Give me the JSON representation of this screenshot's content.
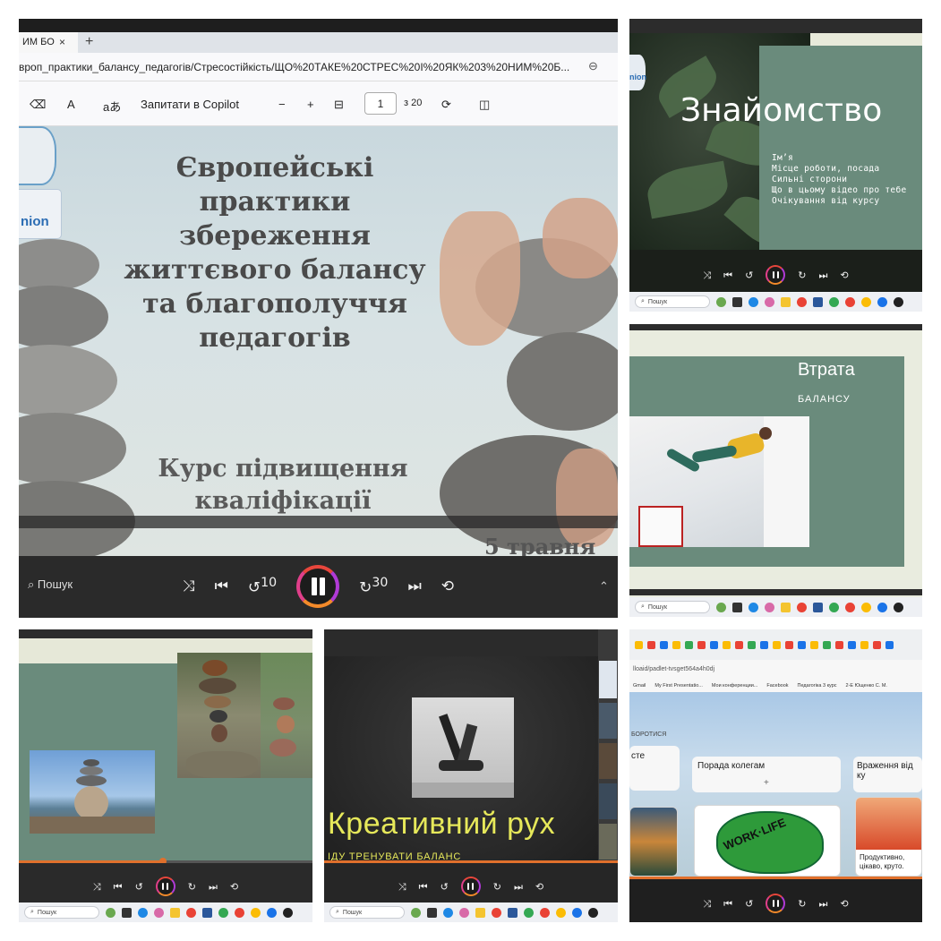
{
  "panel1": {
    "tab_title": "ИМ БО",
    "tab_close": "×",
    "new_tab": "+",
    "address": "вроп_практики_балансу_педагогів/Стресостійкість/ЩО%20ТАКЕ%20СТРЕС%20І%20ЯК%203%20НИМ%20Б...",
    "toolbar": {
      "read_aloud": "A",
      "translate": "aあ",
      "copilot": "Запитати в Copilot",
      "zoom_out": "−",
      "zoom_in": "+",
      "page_current": "1",
      "page_total": "з 20"
    },
    "logo_text": "nion",
    "slide_title": "Європейські практики збереження життєвого балансу та благополуччя педагогів",
    "slide_subtitle": "Курс підвищення кваліфікації",
    "slide_date": "5 травня",
    "taskbar_search": "Пошук",
    "controls": {
      "rewind": "10",
      "forward": "30"
    }
  },
  "panel2": {
    "logo_text": "nion",
    "title": "Знайомство",
    "lines": [
      "Ім’я",
      "Місце роботи, посада",
      "Сильні сторони",
      "Що в цьому відео про тебе",
      "Очікування від курсу"
    ],
    "taskbar_search": "Пошук"
  },
  "panel3": {
    "title": "Втрата",
    "subtitle": "БАЛАНСУ",
    "taskbar_search": "Пошук"
  },
  "panel4": {
    "taskbar_search": "Пошук",
    "progress": 0.49
  },
  "panel5": {
    "title": "Креативний рух",
    "subtitle": "ІДУ ТРЕНУВАТИ БАЛАНС",
    "taskbar_search": "Пошук"
  },
  "panel6": {
    "url": "lloaid/padlet-tvsget564a4h0dj",
    "bookmarks": [
      "Gmail",
      "My First Presentatio...",
      "Мои конференции...",
      "Facebook",
      "Педагогіка 3 курс",
      "2-Е Ющенко С. М."
    ],
    "section_label": "БОРОТИСЯ",
    "col1_title": "сте",
    "col2_title": "Порада колегам",
    "col3_title": "Враження від ку",
    "work_life": "WORK·LIFE",
    "card_text": "Продуктивно, цікаво, круто.",
    "add": "+"
  },
  "colors": {
    "sage_green": "#6a8b7c",
    "creative_yellow": "#e6e85a",
    "progress_orange": "#e0702c"
  }
}
